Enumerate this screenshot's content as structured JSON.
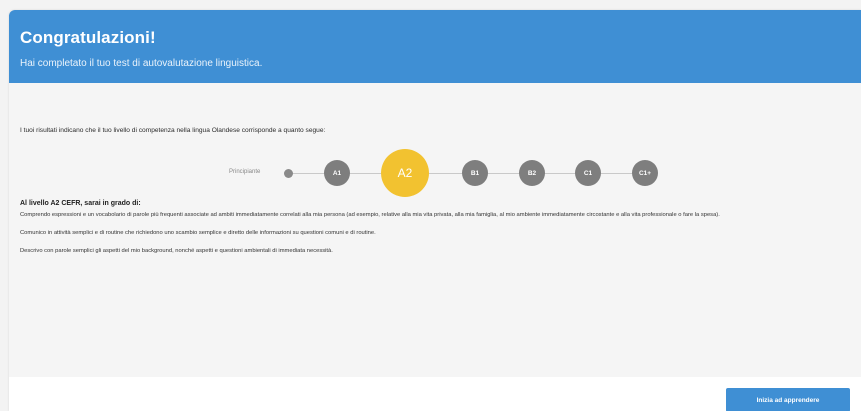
{
  "header": {
    "title": "Congratulazioni!",
    "subtitle": "Hai completato il tuo test di autovalutazione linguistica."
  },
  "intro": "I tuoi risultati indicano che il tuo livello di competenza nella lingua Olandese corrisponde a quanto segue:",
  "scale": {
    "beginner_label": "Principiante",
    "levels": [
      "A1",
      "A2",
      "B1",
      "B2",
      "C1",
      "C1+"
    ],
    "current": "A2"
  },
  "description": {
    "heading": "Al livello A2 CEFR, sarai in grado di:",
    "paragraphs": [
      "Comprendo espressioni e un vocabolario di parole più frequenti associate ad ambiti immediatamente correlati alla mia persona (ad esempio, relative alla mia vita privata, alla mia famiglia, al mio ambiente immediatamente circostante e alla vita professionale o fare la spesa).",
      "Comunico in attività semplici e di routine che richiedono uno scambio semplice e diretto delle informazioni su questioni comuni e di routine.",
      "Descrivo con parole semplici gli aspetti del mio background, nonché aspetti e questioni ambientali di immediata necessità."
    ]
  },
  "cta": {
    "label": "Inizia ad apprendere"
  },
  "colors": {
    "brand": "#3f8fd4",
    "current_level": "#f2c230",
    "level": "#7e7e7e"
  }
}
